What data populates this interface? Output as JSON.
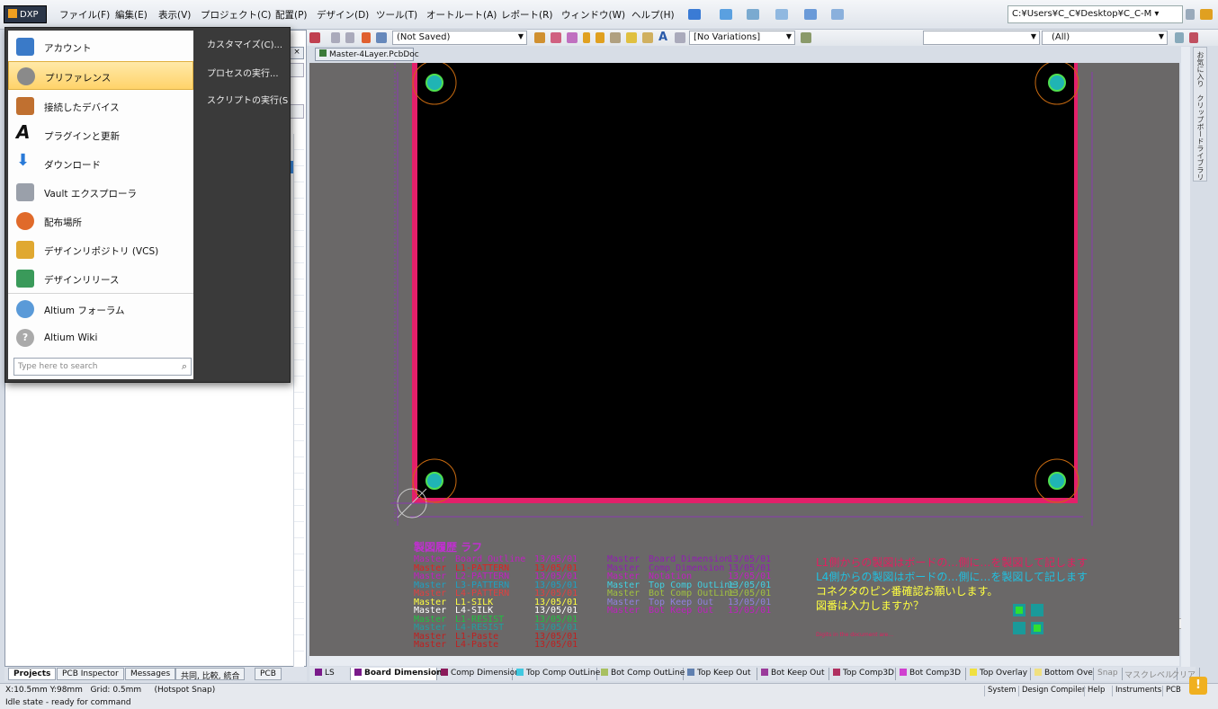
{
  "menubar": {
    "dxp_label": "DXP",
    "items": [
      "ファイル(F)",
      "編集(E)",
      "表示(V)",
      "プロジェクト(C)",
      "配置(P)",
      "デザイン(D)",
      "ツール(T)",
      "オートルート(A)",
      "レポート(R)",
      "ウィンドウ(W)",
      "ヘルプ(H)"
    ],
    "path": "C:¥Users¥C_C¥Desktop¥C_C-M ▾"
  },
  "toolbar": {
    "saved_state": "(Not Saved)",
    "variations": "[No Variations]",
    "filter": "(All)"
  },
  "dxp_menu": {
    "items": [
      {
        "label": "アカウント",
        "icon": "account-icon"
      },
      {
        "label": "プリファレンス",
        "icon": "gear-icon"
      },
      {
        "label": "接続したデバイス",
        "icon": "device-icon"
      },
      {
        "label": "プラグインと更新",
        "icon": "altium-a-icon"
      },
      {
        "label": "ダウンロード",
        "icon": "download-icon"
      },
      {
        "label": "Vault エクスプローラ",
        "icon": "vault-icon"
      },
      {
        "label": "配布場所",
        "icon": "publish-icon"
      },
      {
        "label": "デザインリポジトリ (VCS)",
        "icon": "repository-icon"
      },
      {
        "label": "デザインリリース",
        "icon": "release-icon"
      },
      {
        "label": "Altium フォーラム",
        "icon": "forum-icon"
      },
      {
        "label": "Altium Wiki",
        "icon": "help-icon"
      }
    ],
    "search_placeholder": "Type here to search",
    "sub_items": [
      "カスタマイズ(C)...",
      "プロセスの実行...",
      "スクリプトの実行(S"
    ]
  },
  "document": {
    "tab_label": "Master-4Layer.PcbDoc"
  },
  "right_panel": {
    "tabs": [
      "お気に入り",
      "クリップボード",
      "ライブラリ"
    ]
  },
  "pcb_text": {
    "title": "製図履歴 ラフ",
    "left_rows": [
      {
        "who": "Master",
        "what": "Board Outline",
        "date": "13/05/01",
        "color": "#c020c0"
      },
      {
        "who": "Master",
        "what": "L1-PATTERN",
        "date": "13/05/01",
        "color": "#e02020"
      },
      {
        "who": "Master",
        "what": "L2-PATTERN",
        "date": "13/05/01",
        "color": "#c020c0"
      },
      {
        "who": "Master",
        "what": "L3-PATTERN",
        "date": "13/05/01",
        "color": "#20a0c0"
      },
      {
        "who": "Master",
        "what": "L4-PATTERN",
        "date": "13/05/01",
        "color": "#e04040"
      },
      {
        "who": "Master",
        "what": "L1-SILK",
        "date": "13/05/01",
        "color": "#ffff40"
      },
      {
        "who": "Master",
        "what": "L4-SILK",
        "date": "13/05/01",
        "color": "#ffffff"
      },
      {
        "who": "Master",
        "what": "L1-RESIST",
        "date": "13/05/01",
        "color": "#20c040"
      },
      {
        "who": "Master",
        "what": "L4-RESIST",
        "date": "13/05/01",
        "color": "#20a0a0"
      },
      {
        "who": "Master",
        "what": "L1-Paste",
        "date": "13/05/01",
        "color": "#c02020"
      },
      {
        "who": "Master",
        "what": "L4-Paste",
        "date": "13/05/01",
        "color": "#c02020"
      }
    ],
    "mid_rows": [
      {
        "who": "Master",
        "what": "Board Dimension",
        "date": "13/05/01",
        "color": "#9020b0"
      },
      {
        "who": "Master",
        "what": "Comp Dimension",
        "date": "13/05/01",
        "color": "#9020b0"
      },
      {
        "who": "Master",
        "what": "Notation",
        "date": "13/05/01",
        "color": "#c020c0"
      },
      {
        "who": "Master",
        "what": "Top Comp OutLine",
        "date": "13/05/01",
        "color": "#40d0e0"
      },
      {
        "who": "Master",
        "what": "Bot Comp OutLine",
        "date": "13/05/01",
        "color": "#a0c040"
      },
      {
        "who": "Master",
        "what": "Top Keep Out",
        "date": "13/05/01",
        "color": "#9080e0"
      },
      {
        "who": "Master",
        "what": "Bot Keep Out",
        "date": "13/05/01",
        "color": "#c020c0"
      }
    ],
    "notes": [
      {
        "text": "L1側からの製図はボードの…側に…を製図して記します",
        "color": "#e02060"
      },
      {
        "text": "L4側からの製図はボードの…側に…を製図して記します",
        "color": "#20c0e0"
      },
      {
        "text": "コネクタのピン番確認お願いします。",
        "color": "#ffff40"
      },
      {
        "text": "図番は入力しますか？",
        "color": "#ffff40"
      }
    ],
    "small_note": "Digits in the document are…"
  },
  "panel_tabs": [
    "Projects",
    "PCB Inspector",
    "Messages",
    "共同, 比較, 統合",
    "PCB"
  ],
  "layer_tabs": [
    {
      "label": "LS",
      "color": "#7a1a8a"
    },
    {
      "label": "Board Dimension",
      "color": "#7a1a8a"
    },
    {
      "label": "Comp Dimension",
      "color": "#8a1a5a"
    },
    {
      "label": "Top Comp OutLine",
      "color": "#40c8e0"
    },
    {
      "label": "Bot Comp OutLine",
      "color": "#a8c060"
    },
    {
      "label": "Top Keep Out",
      "color": "#6080b0"
    },
    {
      "label": "Bot Keep Out",
      "color": "#9a3a9a"
    },
    {
      "label": "Top Comp3D",
      "color": "#b03060"
    },
    {
      "label": "Bot Comp3D",
      "color": "#d040d0"
    },
    {
      "label": "Top Overlay",
      "color": "#f0e040"
    },
    {
      "label": "Bottom Ove",
      "color": "#f0e080"
    }
  ],
  "layer_tools": [
    "Snap",
    "マスクレベル",
    "クリア"
  ],
  "status": {
    "coords": "X:10.5mm Y:98mm   Grid: 0.5mm     (Hotspot Snap)",
    "idle": "Idle state - ready for command",
    "buttons": [
      "System",
      "Design Compiler",
      "Help",
      "Instruments",
      "PCB"
    ]
  }
}
